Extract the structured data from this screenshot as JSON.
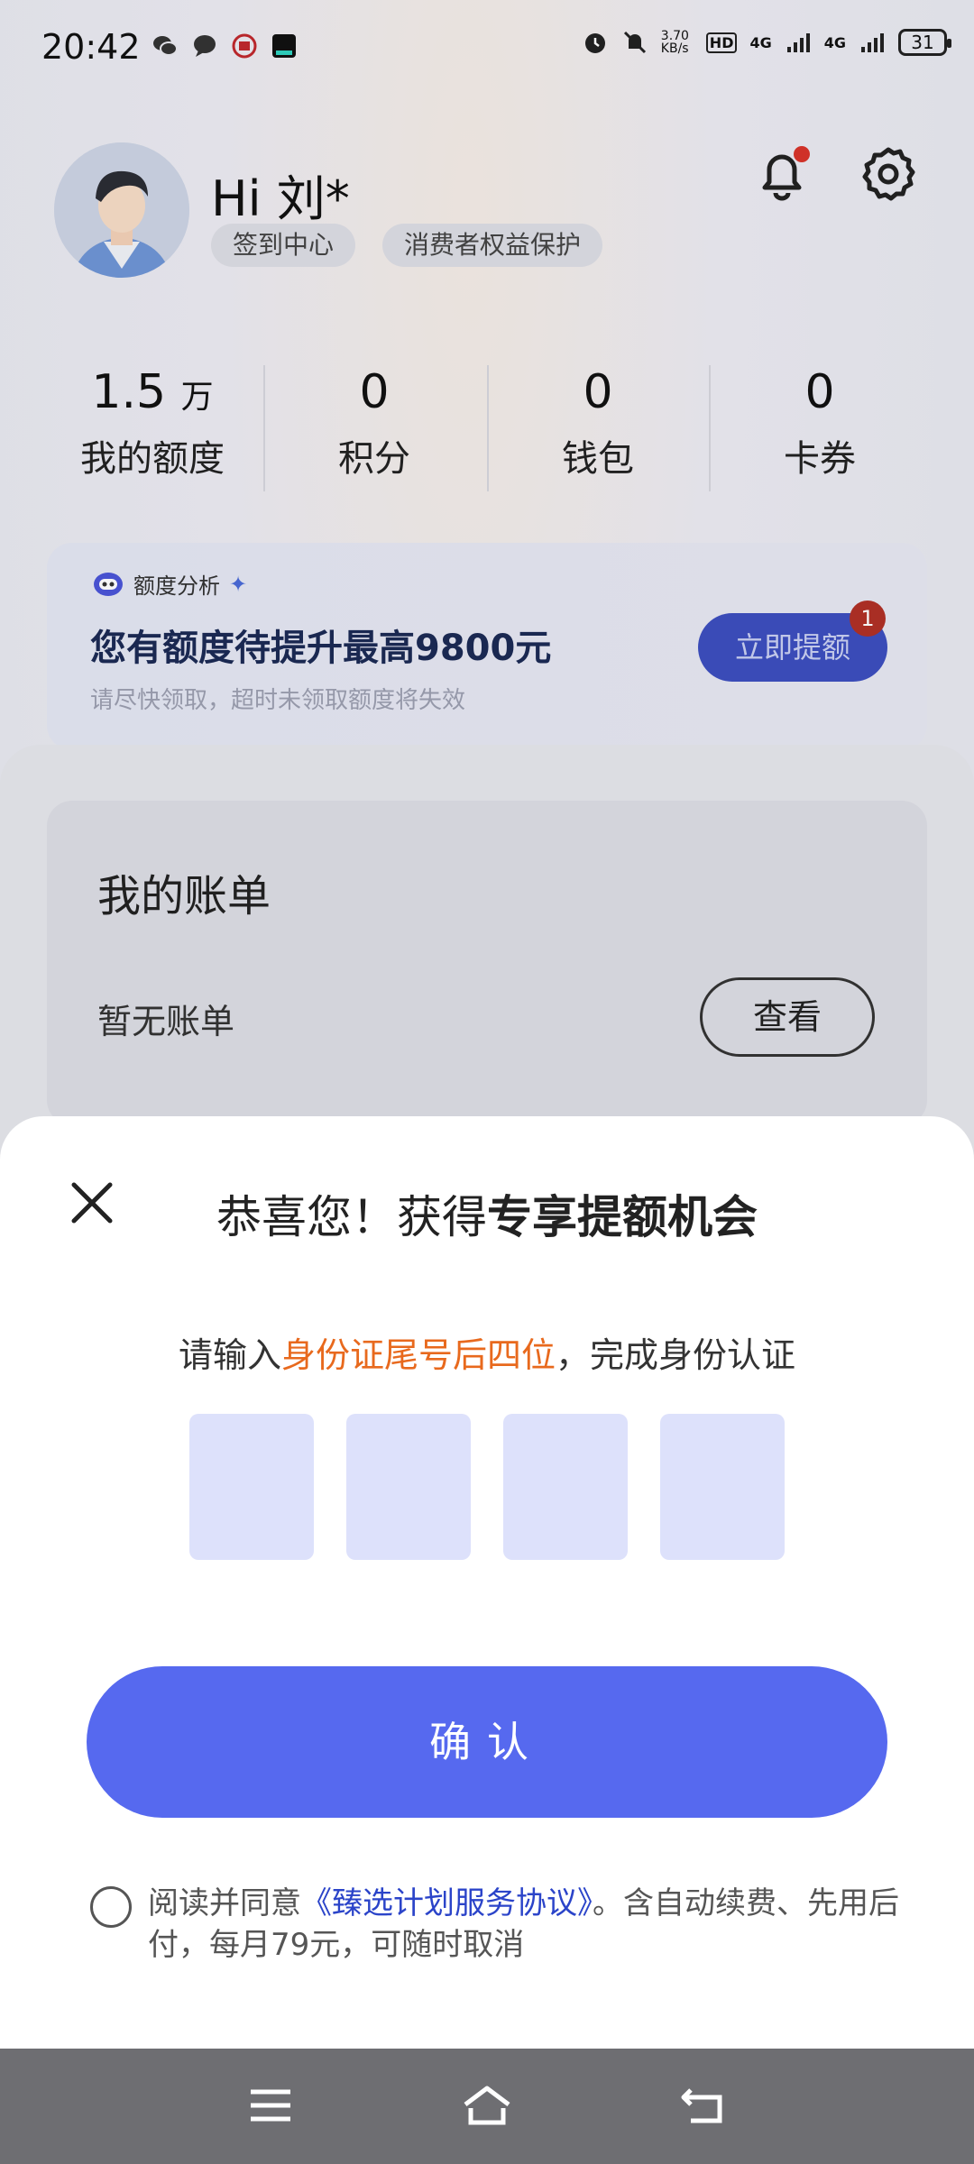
{
  "status_bar": {
    "time": "20:42",
    "net_speed": "3.70\nKB/s",
    "hd": "HD",
    "signal1": "4G",
    "signal2": "4G",
    "battery": "31"
  },
  "profile": {
    "greeting": "Hi 刘*",
    "chips": [
      "签到中心",
      "消费者权益保护"
    ]
  },
  "stats": [
    {
      "value": "1.5",
      "unit": "万",
      "label": "我的额度"
    },
    {
      "value": "0",
      "unit": "",
      "label": "积分"
    },
    {
      "value": "0",
      "unit": "",
      "label": "钱包"
    },
    {
      "value": "0",
      "unit": "",
      "label": "卡券"
    }
  ],
  "promo": {
    "tag": "额度分析",
    "headline": "您有额度待提升最高9800元",
    "sub": "请尽快领取，超时未领取额度将失效",
    "button": "立即提额",
    "badge": "1"
  },
  "bill": {
    "title": "我的账单",
    "empty": "暂无账单",
    "view": "查看"
  },
  "modal": {
    "title_normal": "恭喜您！获得",
    "title_bold": "专享提额机会",
    "instr_pre": "请输入",
    "instr_hl": "身份证尾号后四位",
    "instr_post": "，完成身份认证",
    "confirm": "确认",
    "agree_pre": "阅读并同意",
    "agree_link": "《臻选计划服务协议》",
    "agree_post": "。含自动续费、先用后付，每月79元，可随时取消"
  },
  "colors": {
    "accent": "#5669ef",
    "highlight": "#e8691d",
    "link": "#2b44c9"
  }
}
